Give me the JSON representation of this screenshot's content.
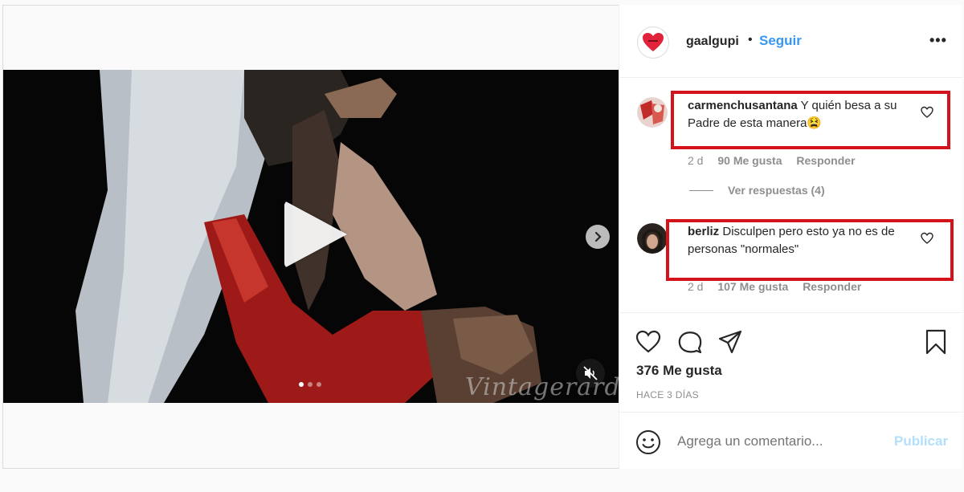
{
  "post": {
    "watermark": "Vintagerard",
    "carousel_dots": 3,
    "carousel_active": 0
  },
  "header": {
    "username": "gaalgupi",
    "separator": "•",
    "follow_label": "Seguir",
    "more_label": "•••"
  },
  "comments": [
    {
      "user": "carmenchusantana",
      "text": "Y quién besa a su Padre de esta manera😫",
      "age": "2 d",
      "likes": "90 Me gusta",
      "reply": "Responder"
    },
    {
      "user": "berliz",
      "text": "Disculpen pero esto ya no es de personas \"normales\"",
      "age": "2 d",
      "likes": "107 Me gusta",
      "reply": "Responder"
    }
  ],
  "view_replies": "Ver respuestas (4)",
  "actions": {
    "likes": "376 Me gusta",
    "time": "HACE 3 DÍAS"
  },
  "composer": {
    "placeholder": "Agrega un comentario...",
    "publish_label": "Publicar"
  },
  "colors": {
    "accent": "#3897f0",
    "highlight": "#d4121c",
    "muted": "#8e8e8e"
  }
}
